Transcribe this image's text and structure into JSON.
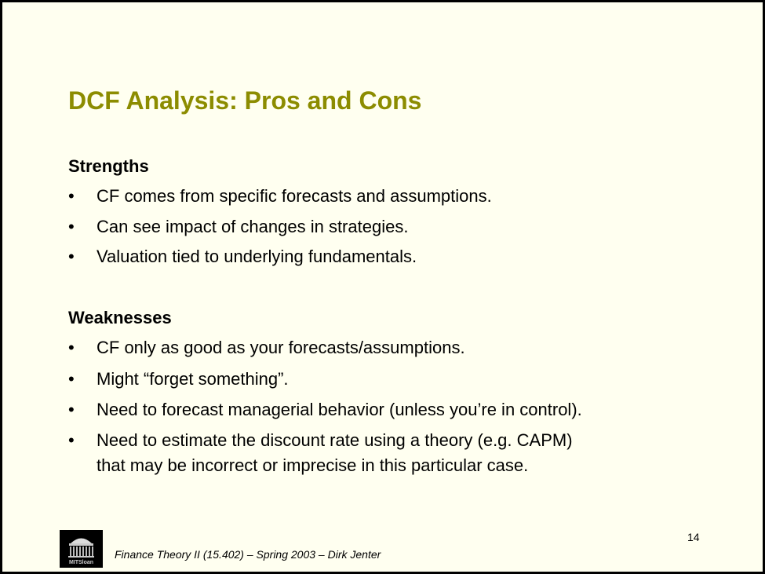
{
  "slide": {
    "title": "DCF Analysis: Pros and Cons",
    "strengths": {
      "heading": "Strengths",
      "bullets": [
        "CF comes from specific forecasts and assumptions.",
        "Can see impact of changes in strategies.",
        "Valuation tied to underlying fundamentals."
      ]
    },
    "weaknesses": {
      "heading": "Weaknesses",
      "bullets": [
        "CF only as good as your forecasts/assumptions.",
        "Might “forget something”.",
        "Need to forecast managerial behavior (unless you’re in control).",
        "Need to estimate the discount rate using a theory (e.g. CAPM)",
        "that may be incorrect or imprecise in this particular case."
      ]
    },
    "bullet_char": "•",
    "page_number": "14",
    "footer": "Finance Theory II (15.402) – Spring 2003 – Dirk Jenter",
    "logo_text": "MITSloan"
  },
  "colors": {
    "title": "#8c8c00",
    "background": "#fffff0"
  }
}
